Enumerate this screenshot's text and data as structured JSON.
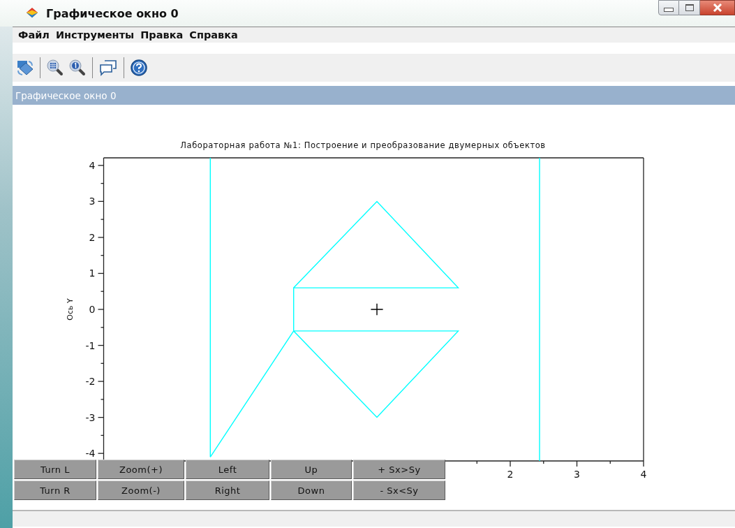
{
  "window": {
    "title": "Графическое окно 0"
  },
  "menu": [
    "Файл",
    "Инструменты",
    "Правка",
    "Справка"
  ],
  "toolbar": [
    {
      "kind": "rotate"
    },
    {
      "kind": "separator"
    },
    {
      "kind": "zoom"
    },
    {
      "kind": "unzoom"
    },
    {
      "kind": "separator"
    },
    {
      "kind": "datatips"
    },
    {
      "kind": "separator"
    },
    {
      "kind": "help"
    }
  ],
  "header": "Графическое окно 0",
  "plot": {
    "chart_data": {
      "type": "line",
      "title": "Лабораторная работа №1: Построение и преобразование двумерных объектов",
      "ylabel": "Ось Y",
      "xlim": [
        -4.1,
        4
      ],
      "ylim": [
        -4.21,
        4.21
      ],
      "xticks": [
        2,
        3,
        4
      ],
      "yticks": [
        -4,
        -3,
        -2,
        -1,
        0,
        1,
        2,
        3,
        4
      ],
      "series": [
        {
          "color": "#00ffff",
          "x": [
            -2.5,
            -2.5
          ],
          "values": [
            4.21,
            -4.1
          ]
        },
        {
          "color": "#00ffff",
          "x": [
            2.44,
            2.44
          ],
          "values": [
            4.21,
            -4.21
          ]
        },
        {
          "color": "#00ffff",
          "x": [
            -1.25,
            0,
            1.22,
            -1.25,
            -1.25,
            1.22,
            0,
            -1.25,
            -2.5
          ],
          "values": [
            0.6,
            3,
            0.6,
            0.6,
            -0.6,
            -0.6,
            -3,
            -0.6,
            -4.1
          ]
        },
        {
          "color": "#000000",
          "x": [
            -0.09,
            0.09,
            null,
            0,
            0
          ],
          "values": [
            0,
            0,
            null,
            -0.16,
            0.16
          ]
        }
      ]
    }
  },
  "buttons": [
    [
      "Turn L",
      "Zoom(+)",
      "Left",
      "Up",
      "+ Sx>Sy"
    ],
    [
      "Turn R",
      "Zoom(-)",
      "Right",
      "Down",
      "- Sx<Sy"
    ]
  ]
}
